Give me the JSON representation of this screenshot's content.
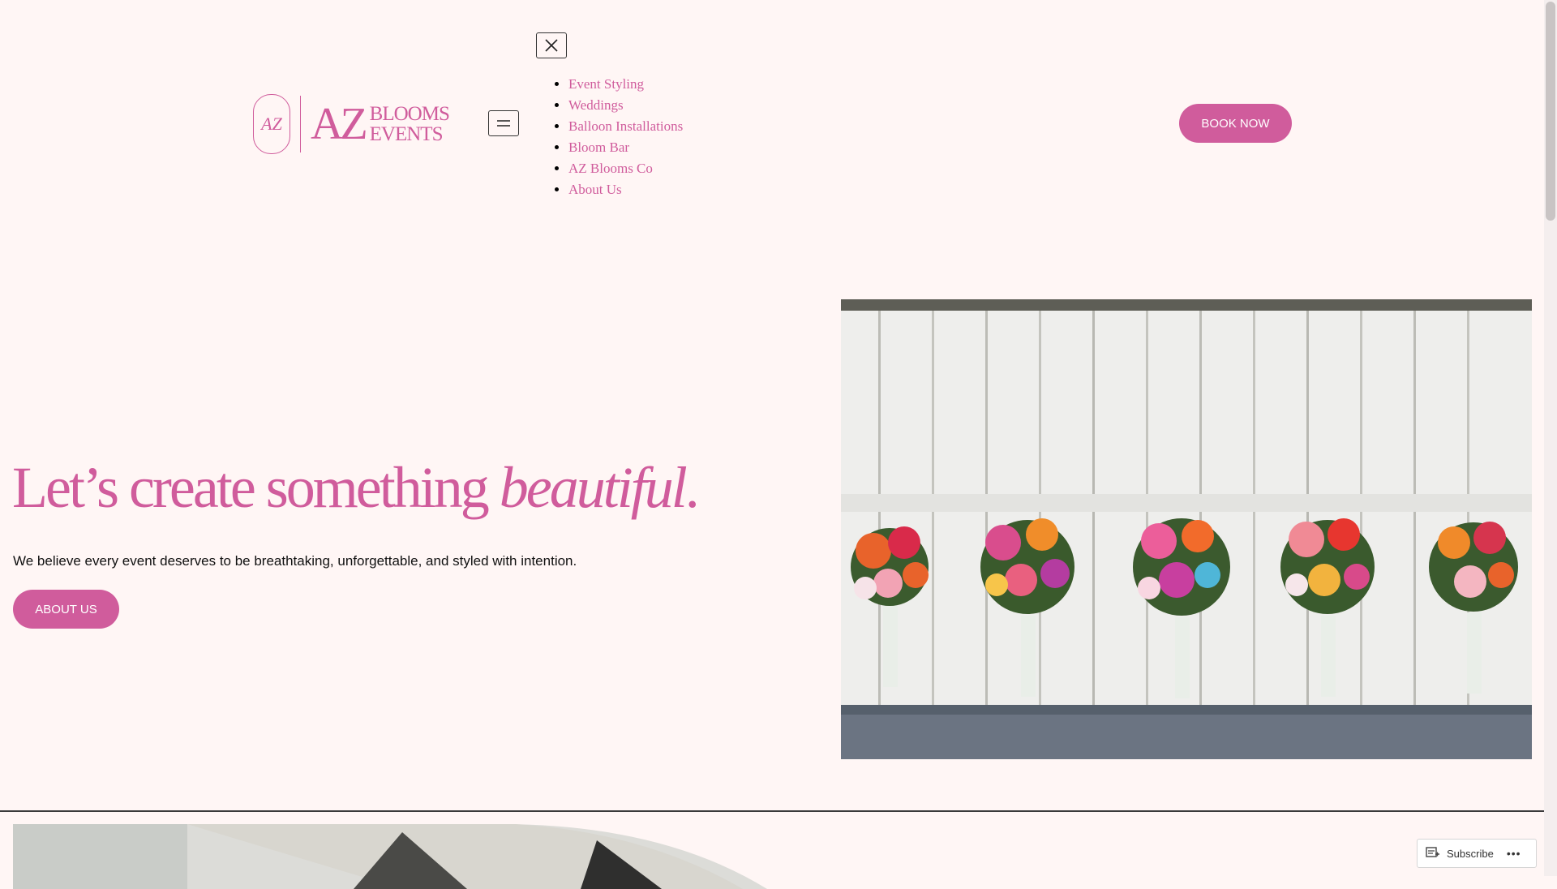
{
  "header": {
    "logo": {
      "monogram": "AZ",
      "az": "AZ",
      "line1": "BLOOMS",
      "line2": "EVENTS",
      "alt": "AZ Blooms & Events"
    },
    "nav_items": [
      {
        "label": "Event Styling"
      },
      {
        "label": "Weddings"
      },
      {
        "label": "Balloon Installations"
      },
      {
        "label": "Bloom Bar"
      },
      {
        "label": "AZ Blooms Co"
      },
      {
        "label": "About Us"
      }
    ],
    "book_label": "BOOK NOW"
  },
  "hero": {
    "title_main": "Let’s create something ",
    "title_em": "beautiful",
    "title_end": ".",
    "text": "We believe every event deserves to be breathtaking, unforgettable, and styled with intention.",
    "about_label": "ABOUT US"
  },
  "footer_bar": {
    "subscribe_label": "Subscribe",
    "more": "•••"
  },
  "colors": {
    "accent": "#d05c9c",
    "background": "#fff6f5"
  },
  "icons": [
    "menu-icon",
    "close-icon",
    "subscribe-icon",
    "more-icon"
  ]
}
